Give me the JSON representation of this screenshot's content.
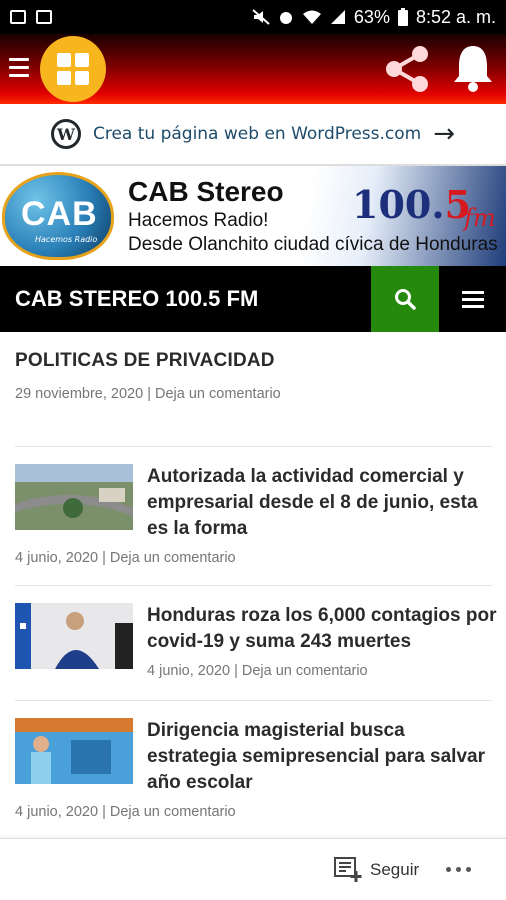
{
  "status_bar": {
    "battery": "63%",
    "time": "8:52 a. m."
  },
  "wp_banner": {
    "text": "Crea tu página web en WordPress.com",
    "arrow": "→"
  },
  "cab_banner": {
    "logo_text": "CAB",
    "logo_small": "Hacemos Radio",
    "title": "CAB Stereo",
    "line1": "Hacemos Radio!",
    "line2": "Desde Olanchito ciudad cívica de Honduras",
    "freq_main": "100.",
    "freq_red": "5",
    "freq_unit": "fm"
  },
  "site": {
    "title": "CAB STEREO 100.5 FM"
  },
  "page_post": {
    "title": "POLITICAS DE PRIVACIDAD",
    "date": "29 noviembre, 2020",
    "sep": "|",
    "comment": "Deja un comentario"
  },
  "articles": [
    {
      "title": "Autorizada la actividad comercial y empresarial desde el 8 de junio, esta es la forma",
      "date": "4 junio, 2020",
      "sep": "|",
      "comment": "Deja un comentario"
    },
    {
      "title": "Honduras roza los 6,000 contagios por covid-19 y suma 243 muertes",
      "date": "4 junio, 2020",
      "sep": "|",
      "comment": "Deja un comentario"
    },
    {
      "title": "Dirigencia magisterial busca estrategia semipresencial para salvar año escolar",
      "date": "4 junio, 2020",
      "sep": "|",
      "comment": "Deja un comentario"
    }
  ],
  "follow_bar": {
    "label": "Seguir"
  },
  "colors": {
    "accent_green": "#24890d",
    "header_red": "#e00000",
    "logo_yellow": "#f7b51e"
  },
  "icons": [
    "hamburger-icon",
    "grid-logo-icon",
    "share-icon",
    "bell-icon",
    "wordpress-icon",
    "search-icon",
    "menu-icon",
    "follow-icon",
    "more-icon"
  ]
}
